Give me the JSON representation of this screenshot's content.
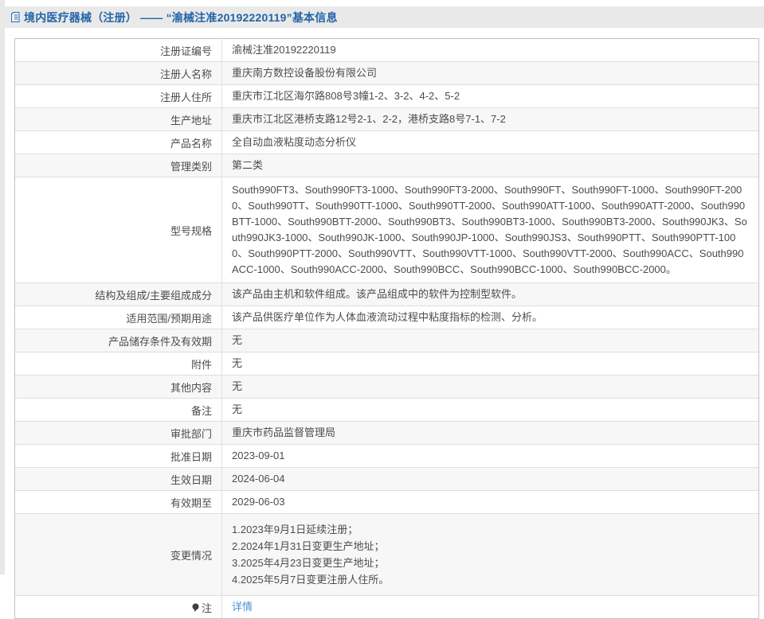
{
  "header": {
    "title": "境内医疗器械（注册） —— “渝械注准20192220119”基本信息"
  },
  "table": {
    "rows": [
      {
        "label": "注册证编号",
        "value": "渝械注准20192220119"
      },
      {
        "label": "注册人名称",
        "value": "重庆南方数控设备股份有限公司"
      },
      {
        "label": "注册人住所",
        "value": "重庆市江北区海尔路808号3幢1-2、3-2、4-2、5-2"
      },
      {
        "label": "生产地址",
        "value": "重庆市江北区港桥支路12号2-1、2-2，港桥支路8号7-1、7-2"
      },
      {
        "label": "产品名称",
        "value": "全自动血液粘度动态分析仪"
      },
      {
        "label": "管理类别",
        "value": "第二类"
      },
      {
        "label": "型号规格",
        "value": "South990FT3、South990FT3-1000、South990FT3-2000、South990FT、South990FT-1000、South990FT-2000、South990TT、South990TT-1000、South990TT-2000、South990ATT-1000、South990ATT-2000、South990BTT-1000、South990BTT-2000、South990BT3、South990BT3-1000、South990BT3-2000、South990JK3、South990JK3-1000、South990JK-1000、South990JP-1000、South990JS3、South990PTT、South990PTT-1000、South990PTT-2000、South990VTT、South990VTT-1000、South990VTT-2000、South990ACC、South990ACC-1000、South990ACC-2000、South990BCC、South990BCC-1000、South990BCC-2000。"
      },
      {
        "label": "结构及组成/主要组成成分",
        "value": "该产品由主机和软件组成。该产品组成中的软件为控制型软件。"
      },
      {
        "label": "适用范围/预期用途",
        "value": "该产品供医疗单位作为人体血液流动过程中粘度指标的检测、分析。"
      },
      {
        "label": "产品储存条件及有效期",
        "value": "无"
      },
      {
        "label": "附件",
        "value": "无"
      },
      {
        "label": "其他内容",
        "value": "无"
      },
      {
        "label": "备注",
        "value": "无"
      },
      {
        "label": "审批部门",
        "value": "重庆市药品监督管理局"
      },
      {
        "label": "批准日期",
        "value": "2023-09-01"
      },
      {
        "label": "生效日期",
        "value": "2024-06-04"
      },
      {
        "label": "有效期至",
        "value": "2029-06-03"
      },
      {
        "label": "变更情况",
        "lines": [
          "1.2023年9月1日延续注册；",
          "2.2024年1月31日变更生产地址；",
          "3.2025年4月23日变更生产地址；",
          "4.2025年5月7日变更注册人住所。"
        ]
      },
      {
        "label": "注",
        "link": "详情"
      }
    ]
  },
  "colors": {
    "title_blue": "#2264a7",
    "link_blue": "#4a90d2",
    "band_gray": "#e9e9e9",
    "stripe_gray": "#f7f7f7",
    "outer_border": "#c2c2c2",
    "inner_border": "#dedede",
    "text": "#4c4c4c"
  }
}
